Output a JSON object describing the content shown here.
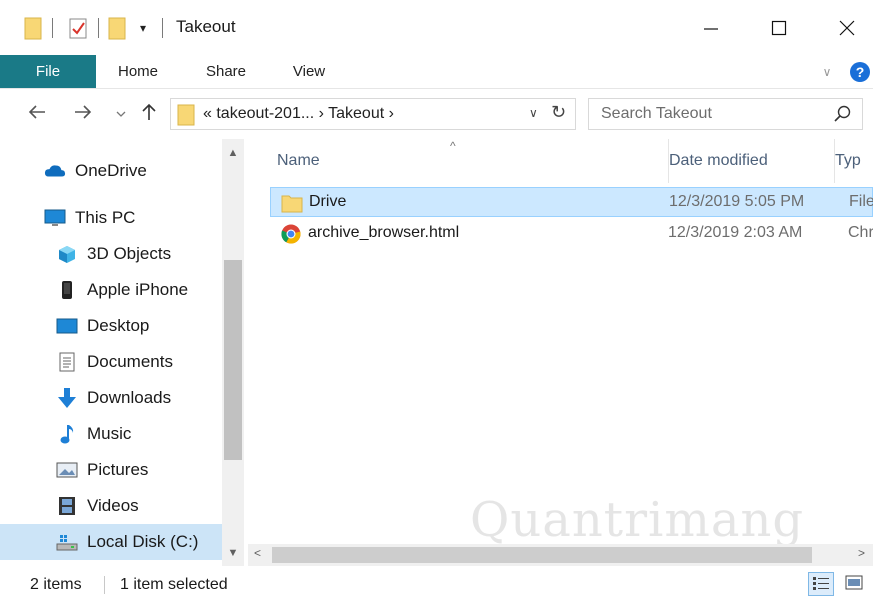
{
  "window": {
    "title": "Takeout",
    "quick_access_dropdown": "▾"
  },
  "ribbon": {
    "tabs": [
      {
        "label": "File"
      },
      {
        "label": "Home"
      },
      {
        "label": "Share"
      },
      {
        "label": "View"
      }
    ],
    "help_label": "?"
  },
  "address_bar": {
    "path": "« takeout-201... › Takeout ›"
  },
  "search": {
    "placeholder": "Search Takeout"
  },
  "nav_pane": {
    "items": [
      {
        "label": "OneDrive",
        "icon": "cloud-icon"
      },
      {
        "label": "This PC",
        "icon": "monitor-icon"
      },
      {
        "label": "3D Objects",
        "icon": "cube-icon"
      },
      {
        "label": "Apple iPhone",
        "icon": "phone-icon"
      },
      {
        "label": "Desktop",
        "icon": "desktop-icon"
      },
      {
        "label": "Documents",
        "icon": "document-icon"
      },
      {
        "label": "Downloads",
        "icon": "download-arrow-icon"
      },
      {
        "label": "Music",
        "icon": "music-note-icon"
      },
      {
        "label": "Pictures",
        "icon": "picture-icon"
      },
      {
        "label": "Videos",
        "icon": "film-icon"
      },
      {
        "label": "Local Disk (C:)",
        "icon": "disk-drive-icon",
        "selected": true
      }
    ]
  },
  "file_list": {
    "columns": {
      "name": "Name",
      "date": "Date modified",
      "type": "Typ"
    },
    "rows": [
      {
        "name": "Drive",
        "date": "12/3/2019 5:05 PM",
        "type": "File",
        "icon": "folder-icon",
        "selected": true
      },
      {
        "name": "archive_browser.html",
        "date": "12/3/2019 2:03 AM",
        "type": "Chr",
        "icon": "chrome-icon",
        "selected": false
      }
    ]
  },
  "status": {
    "item_count": "2 items",
    "selection": "1 item selected"
  },
  "watermark": {
    "text": "Quantrimang"
  },
  "colors": {
    "file_tab": "#1a7a87",
    "selection": "#cce8ff",
    "folder_yellow": "#f8d775",
    "accent_blue": "#1a6fd8"
  }
}
